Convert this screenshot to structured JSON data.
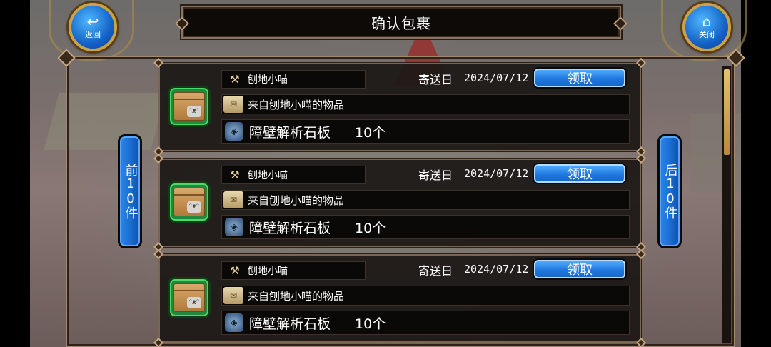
{
  "header": {
    "title": "确认包裹",
    "back_label": "返回",
    "close_label": "关闭"
  },
  "nav": {
    "prev_label": "前10件",
    "next_label": "后10件"
  },
  "mails": [
    {
      "sender": "刨地小喵",
      "date_label": "寄送日",
      "date": "2024/07/12",
      "claim_label": "领取",
      "message": "来自刨地小喵的物品",
      "item_name": "障壁解析石板",
      "item_qty": "10个"
    },
    {
      "sender": "刨地小喵",
      "date_label": "寄送日",
      "date": "2024/07/12",
      "claim_label": "领取",
      "message": "来自刨地小喵的物品",
      "item_name": "障壁解析石板",
      "item_qty": "10个"
    },
    {
      "sender": "刨地小喵",
      "date_label": "寄送日",
      "date": "2024/07/12",
      "claim_label": "领取",
      "message": "来自刨地小喵的物品",
      "item_name": "障壁解析石板",
      "item_qty": "10个"
    }
  ],
  "icons": {
    "back": "back-arrow-icon",
    "close": "home-icon",
    "package": "package-box-icon",
    "sender": "sender-tools-icon",
    "message": "scroll-letter-icon",
    "item": "stone-tablet-icon"
  },
  "colors": {
    "claim_button": "#1f78e0",
    "nav_button": "#1b6fd4",
    "frame": "#a2886c",
    "package_bg": "#1f8a3a"
  }
}
